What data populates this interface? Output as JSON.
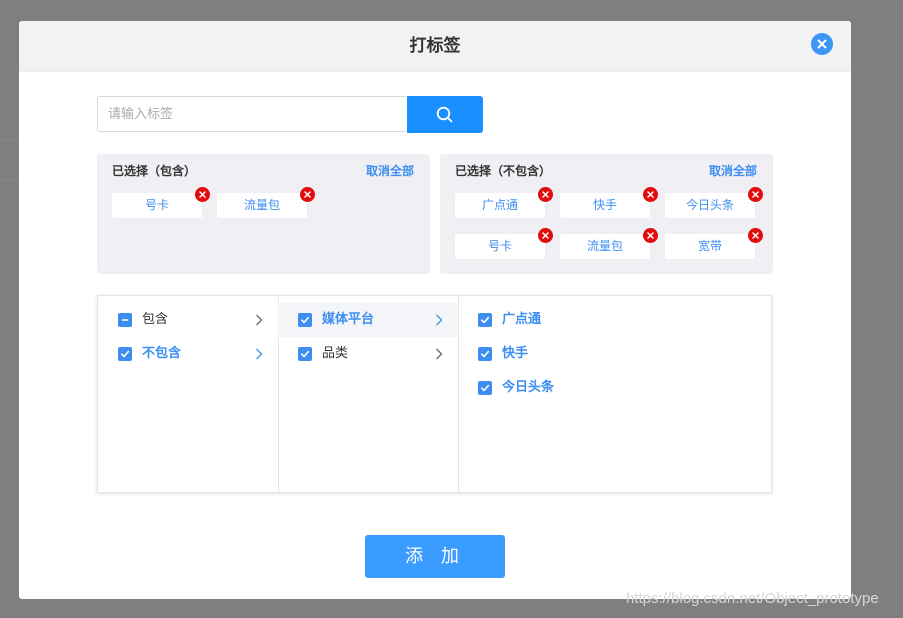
{
  "dialog": {
    "title": "打标签",
    "close_icon": "close-icon",
    "add_label": "添 加"
  },
  "search": {
    "placeholder": "请输入标签",
    "value": "",
    "icon": "search-icon"
  },
  "selected_include": {
    "title": "已选择（包含）",
    "clear_label": "取消全部",
    "tags": [
      "号卡",
      "流量包"
    ]
  },
  "selected_exclude": {
    "title": "已选择（不包含）",
    "clear_label": "取消全部",
    "tags": [
      "广点通",
      "快手",
      "今日头条",
      "号卡",
      "流量包",
      "宽带"
    ]
  },
  "cascader": {
    "level1": [
      {
        "label": "包含",
        "state": "indeterminate"
      },
      {
        "label": "不包含",
        "state": "checked"
      }
    ],
    "level2": [
      {
        "label": "媒体平台",
        "state": "checked"
      },
      {
        "label": "品类",
        "state": "checked"
      }
    ],
    "level3": [
      {
        "label": "广点通",
        "state": "checked"
      },
      {
        "label": "快手",
        "state": "checked"
      },
      {
        "label": "今日头条",
        "state": "checked"
      }
    ]
  },
  "colors": {
    "primary": "#1890ff",
    "accent_text": "#3d8ef0",
    "remove": "#e00d0d",
    "panel_bg": "#efeff4"
  },
  "watermark": "https://blog.csdn.net/Object_prototype"
}
